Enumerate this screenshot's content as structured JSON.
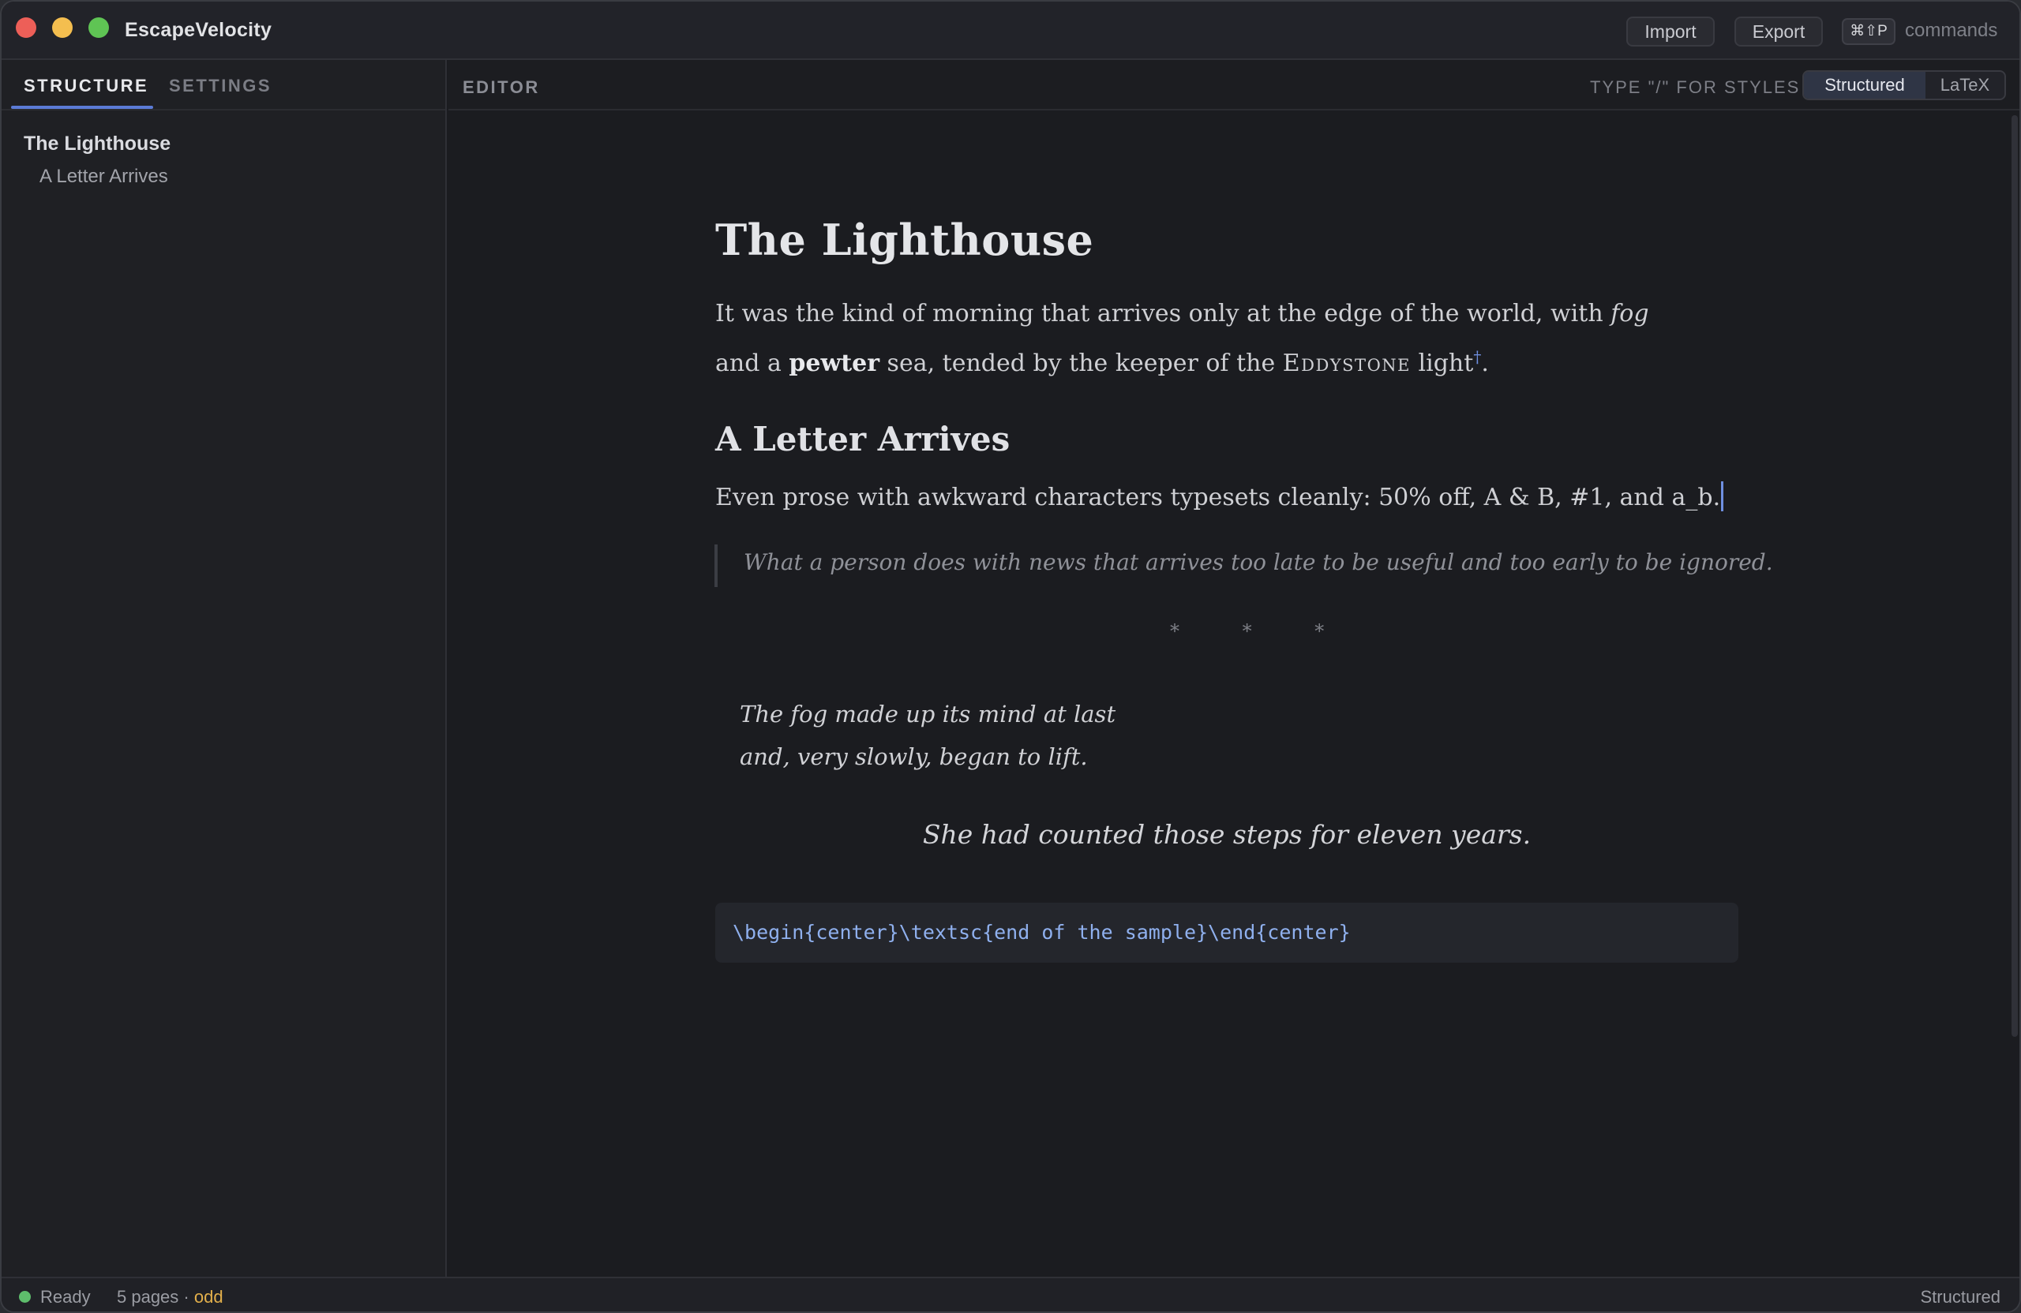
{
  "app": {
    "title": "EscapeVelocity"
  },
  "toolbar": {
    "import_label": "Import",
    "export_label": "Export",
    "shortcut": "⌘⇧P",
    "commands_label": "commands"
  },
  "sidebar": {
    "tabs": [
      {
        "label": "STRUCTURE",
        "active": true
      },
      {
        "label": "SETTINGS",
        "active": false
      }
    ],
    "outline": [
      {
        "label": "The Lighthouse",
        "level": 1
      },
      {
        "label": "A Letter Arrives",
        "level": 2
      }
    ]
  },
  "editor": {
    "label": "EDITOR",
    "hint": "TYPE \"/\" FOR STYLES",
    "modes": [
      {
        "label": "Structured",
        "active": true
      },
      {
        "label": "LaTeX",
        "active": false
      }
    ]
  },
  "doc": {
    "title": "The Lighthouse",
    "para1": {
      "t1": "It was the kind of morning that arrives only at the edge of the world, with ",
      "italic": "fog",
      "t2": " and a ",
      "bold": "pewter",
      "t3": " sea, tended by the keeper of the ",
      "smallcaps": "Eddystone",
      "t4": " light",
      "dagger": "†",
      "t5": "."
    },
    "heading2": "A Letter Arrives",
    "para2": "Even prose with awkward characters typesets cleanly: 50% off, A & B, #1, and a_b.",
    "quote": "What a person does with news that arrives too late to be useful and too early to be ignored.",
    "separator": "* * *",
    "verse": [
      "The fog made up its mind at last",
      "and, very slowly, began to lift."
    ],
    "centered": "She had counted those steps for eleven years.",
    "code": "\\begin{center}\\textsc{end of the sample}\\end{center}"
  },
  "status": {
    "ready": "Ready",
    "pages": "5 pages",
    "sep": " · ",
    "parity": "odd",
    "mode": "Structured",
    "ready_color": "#5ebd6c",
    "parity_color": "#e3b04b"
  },
  "colors": {
    "accent": "#5b7bd6",
    "link": "#6f8fe0"
  }
}
